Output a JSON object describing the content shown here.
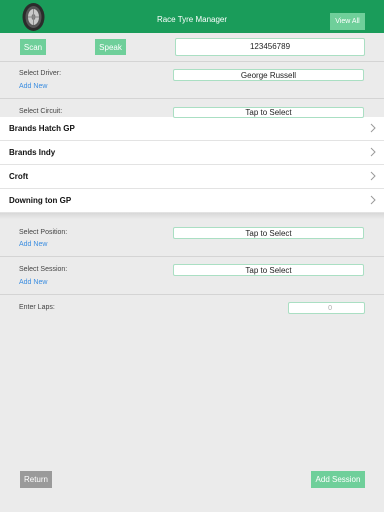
{
  "header": {
    "title": "Race Tyre Manager",
    "view_all": "View All",
    "logo_icon": "tyre-icon"
  },
  "scan": {
    "scan_label": "Scan",
    "speak_label": "Speak",
    "code_value": "123456789"
  },
  "driver": {
    "label": "Select Driver:",
    "value": "George Russell",
    "add_new": "Add New"
  },
  "circuit": {
    "label": "Select Circuit:",
    "value": "Tap to Select",
    "options": [
      "Brands Hatch GP",
      "Brands Indy",
      "Croft",
      "Downing ton GP"
    ]
  },
  "position": {
    "label": "Select Position:",
    "value": "Tap to Select",
    "add_new": "Add New"
  },
  "session": {
    "label": "Select Session:",
    "value": "Tap to Select",
    "add_new": "Add New"
  },
  "laps": {
    "label": "Enter Laps:",
    "value": "0"
  },
  "footer": {
    "return_label": "Return",
    "add_session_label": "Add Session"
  },
  "colors": {
    "header": "#1a9c5a",
    "button": "#6fcf9a",
    "link": "#3b8de0",
    "return_button": "#9a9a9a"
  }
}
